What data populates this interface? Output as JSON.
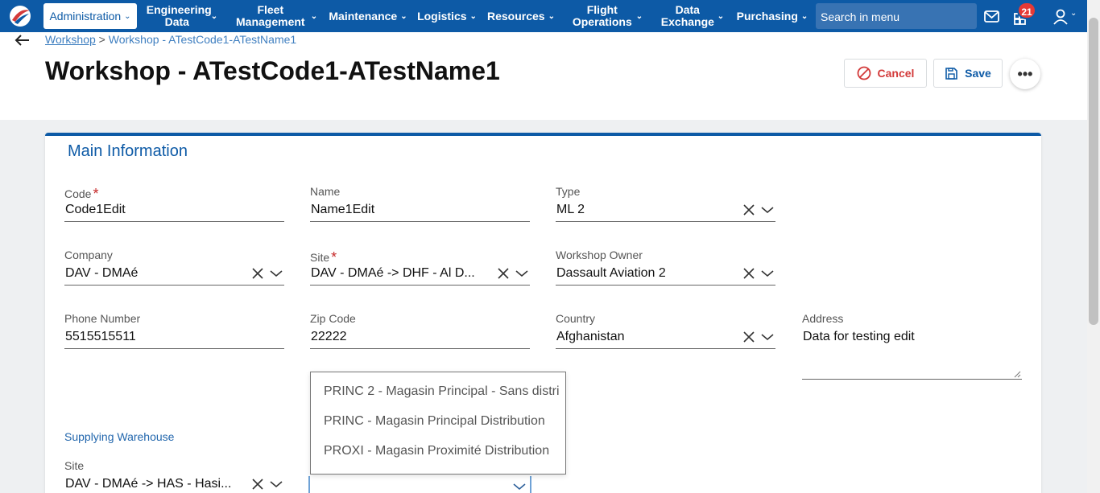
{
  "nav": {
    "items": [
      {
        "label": "Administration",
        "active": true
      },
      {
        "label": "Engineering Data"
      },
      {
        "label": "Fleet Management"
      },
      {
        "label": "Maintenance"
      },
      {
        "label": "Logistics"
      },
      {
        "label": "Resources"
      },
      {
        "label": "Flight Operations"
      },
      {
        "label": "Data Exchange"
      },
      {
        "label": "Purchasing"
      }
    ],
    "search_placeholder": "Search in menu",
    "notification_count": "21",
    "icons": [
      "logo-icon",
      "mail-icon",
      "notifications-icon",
      "user-icon"
    ],
    "colors": {
      "bar": "#0d5aa6",
      "badge": "#e53935"
    }
  },
  "breadcrumb": {
    "root": "Workshop",
    "separator": ">",
    "current": "Workshop - ATestCode1-ATestName1"
  },
  "page": {
    "title": "Workshop - ATestCode1-ATestName1",
    "cancel_label": "Cancel",
    "save_label": "Save",
    "more_label": "•••"
  },
  "section": {
    "title": "Main Information"
  },
  "fields": {
    "code": {
      "label": "Code",
      "required": "*",
      "value": "Code1Edit"
    },
    "name": {
      "label": "Name",
      "value": "Name1Edit"
    },
    "type": {
      "label": "Type",
      "value": "ML 2"
    },
    "company": {
      "label": "Company",
      "value": "DAV - DMAé"
    },
    "site": {
      "label": "Site",
      "required": "*",
      "value": "DAV - DMAé -> DHF - Al D..."
    },
    "workshop_owner": {
      "label": "Workshop Owner",
      "value": "Dassault Aviation 2"
    },
    "phone": {
      "label": "Phone Number",
      "value": "5515515511"
    },
    "zip": {
      "label": "Zip Code",
      "value": "22222"
    },
    "country": {
      "label": "Country",
      "value": "Afghanistan"
    },
    "address": {
      "label": "Address",
      "value": "Data for testing edit"
    }
  },
  "supplying": {
    "title": "Supplying Warehouse",
    "site": {
      "label": "Site",
      "value": "DAV - DMAé -> HAS - Hasi..."
    }
  },
  "dropdown": {
    "options": [
      "PRINC 2 - Magasin Principal - Sans distri",
      "PRINC - Magasin Principal Distribution",
      "PROXI - Magasin Proximité Distribution"
    ]
  }
}
